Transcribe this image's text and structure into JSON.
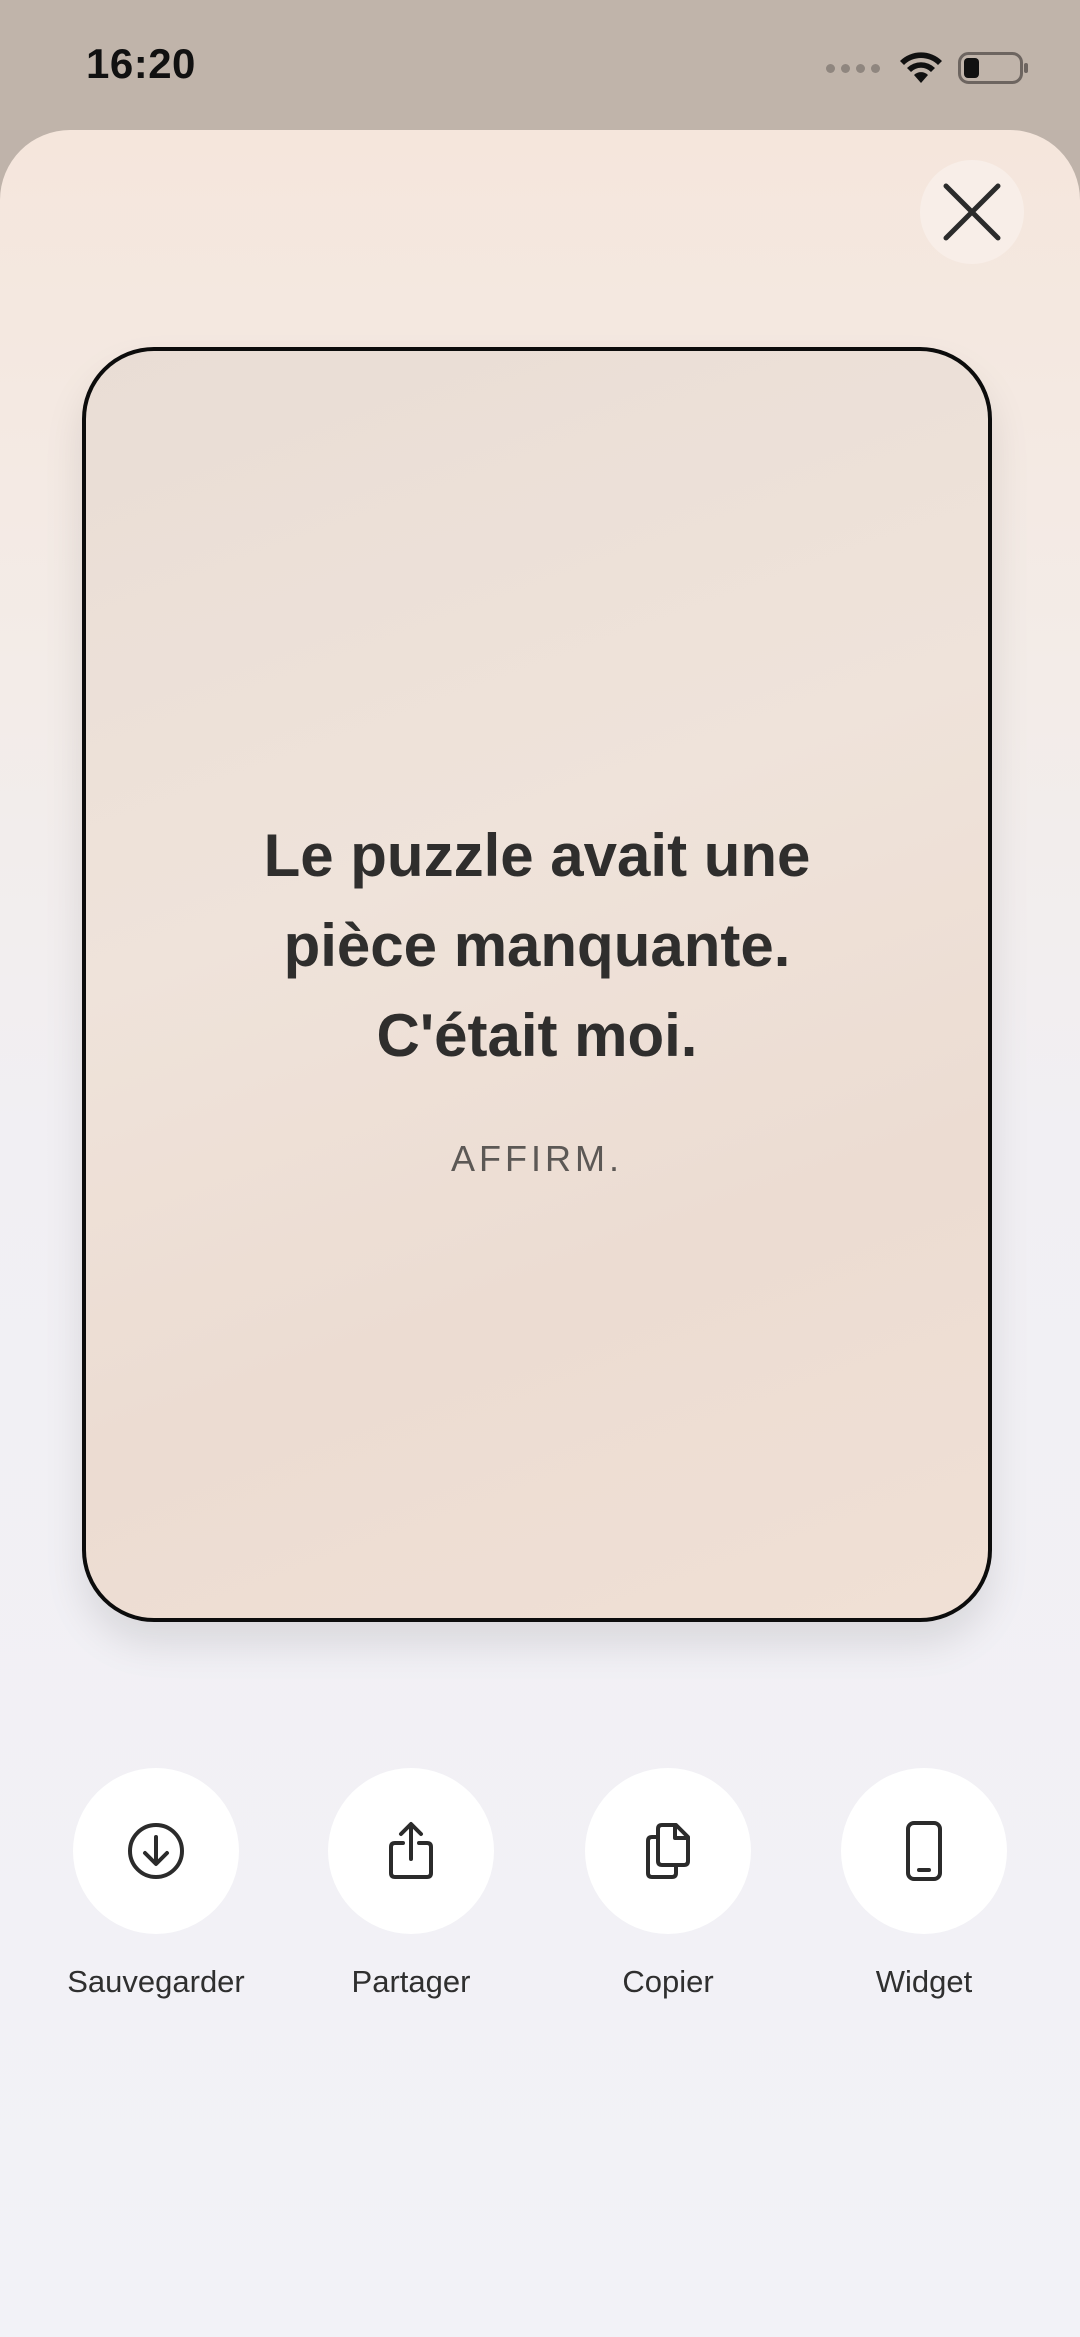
{
  "status": {
    "time": "16:20"
  },
  "card": {
    "quote": "Le puzzle avait une pièce manquante. C'était moi.",
    "brand": "AFFIRM."
  },
  "actions": [
    {
      "label": "Sauvegarder",
      "icon": "download-circle-icon"
    },
    {
      "label": "Partager",
      "icon": "share-icon"
    },
    {
      "label": "Copier",
      "icon": "copy-icon"
    },
    {
      "label": "Widget",
      "icon": "phone-icon"
    }
  ],
  "icons": {
    "close": "close-icon",
    "wifi": "wifi-icon",
    "battery": "battery-icon",
    "signal": "signal-dots-icon"
  }
}
